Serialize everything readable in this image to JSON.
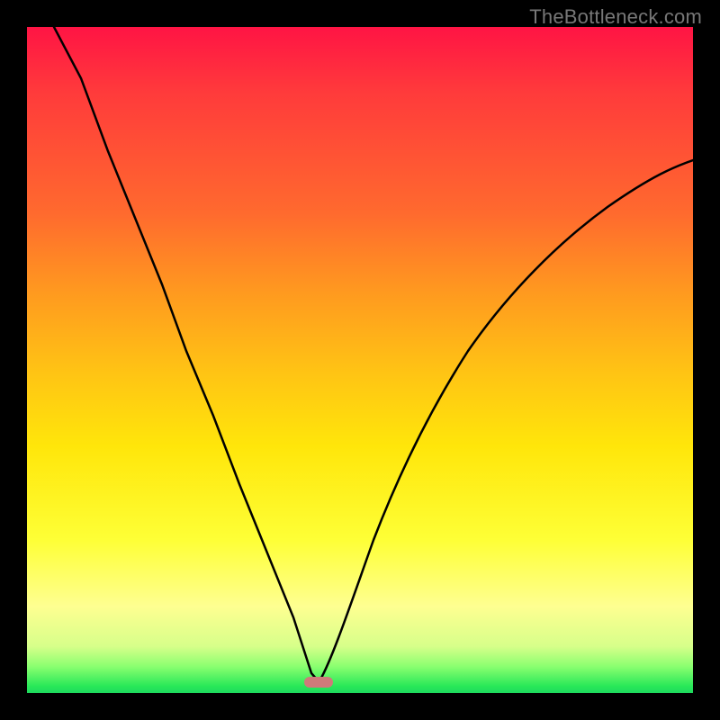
{
  "watermark": "TheBottleneck.com",
  "chart_data": {
    "type": "line",
    "title": "",
    "xlabel": "",
    "ylabel": "",
    "xlim": [
      0,
      100
    ],
    "ylim": [
      0,
      100
    ],
    "grid": false,
    "legend": false,
    "gradient_stops": [
      {
        "pos": 0,
        "color": "#ff1444"
      },
      {
        "pos": 28,
        "color": "#ff6a2e"
      },
      {
        "pos": 52,
        "color": "#ffc414"
      },
      {
        "pos": 77,
        "color": "#feff36"
      },
      {
        "pos": 93,
        "color": "#d7ff8a"
      },
      {
        "pos": 100,
        "color": "#1ed95d"
      }
    ],
    "marker": {
      "x": 43.5,
      "y": 2,
      "color": "#cf7a7a"
    },
    "series": [
      {
        "name": "left-branch",
        "x": [
          4,
          8,
          12,
          16,
          20,
          24,
          28,
          32,
          36,
          40,
          43
        ],
        "y": [
          100,
          90,
          79,
          69,
          59,
          49,
          39,
          29,
          19,
          9,
          2
        ]
      },
      {
        "name": "right-branch",
        "x": [
          44,
          48,
          52,
          56,
          60,
          64,
          70,
          76,
          82,
          88,
          94,
          100
        ],
        "y": [
          2,
          11,
          21,
          30,
          38,
          45,
          53,
          60,
          66,
          71,
          75,
          78
        ]
      }
    ]
  }
}
